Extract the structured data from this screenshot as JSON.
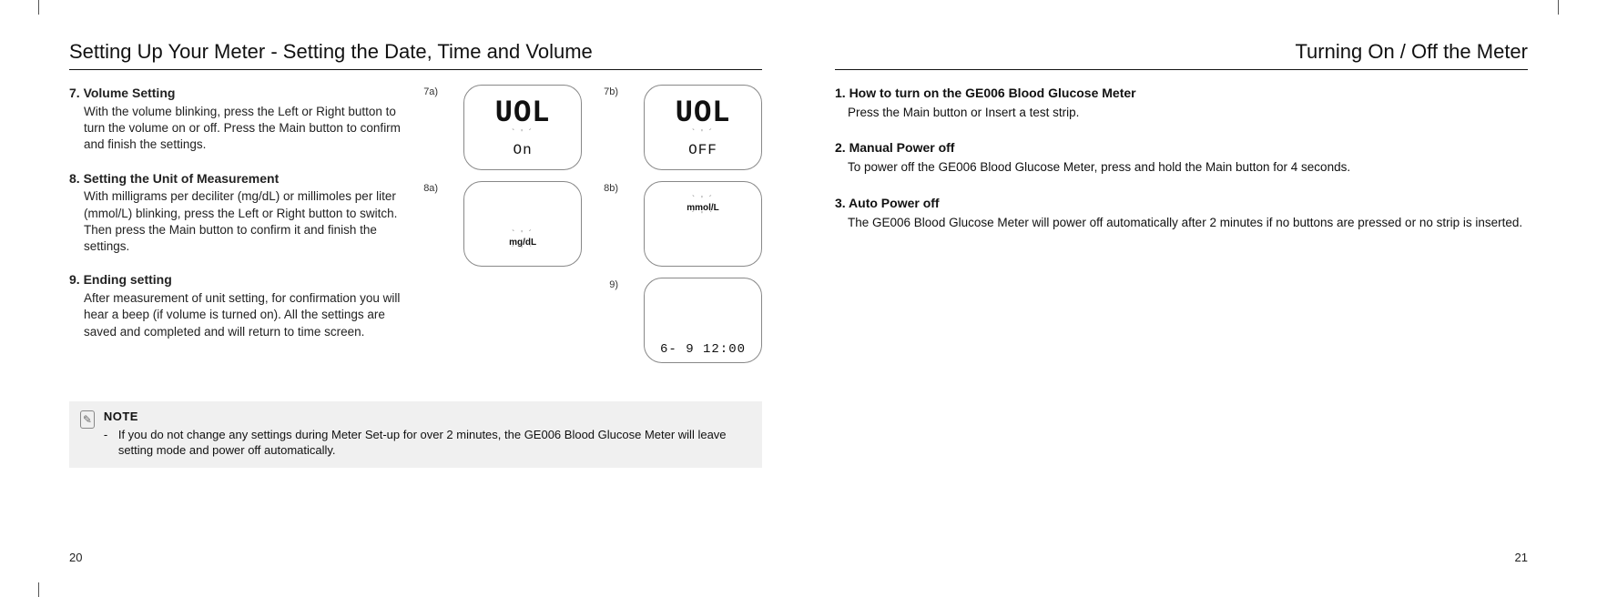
{
  "left": {
    "heading": "Setting Up Your Meter - Setting the Date, Time and Volume",
    "page_number": "20",
    "sections": [
      {
        "title": "7. Volume Setting",
        "body": "With the volume blinking, press the Left or Right button to turn the volume on or off. Press the Main button to confirm and finish the settings."
      },
      {
        "title": "8. Setting the Unit of Measurement",
        "body": "With milligrams per deciliter (mg/dL) or millimoles per liter (mmol/L) blinking, press the Left or Right button to switch. Then press the Main button to confirm it and finish the settings."
      },
      {
        "title": "9. Ending setting",
        "body": "After measurement of unit setting, for confirmation you will hear a beep (if volume is turned on). All the settings are saved and completed and will return to time screen."
      }
    ],
    "note": {
      "label": "NOTE",
      "body": "If you do not change any settings during Meter Set-up for over 2 minutes, the GE006 Blood Glucose Meter will leave setting mode and power off automatically."
    },
    "figures": {
      "f7a": {
        "label": "7a)",
        "big": "UOL",
        "small": "On"
      },
      "f7b": {
        "label": "7b)",
        "big": "UOL",
        "small": "OFF"
      },
      "f8a": {
        "label": "8a)",
        "unit": "mg/dL"
      },
      "f8b": {
        "label": "8b)",
        "unit": "mmol/L"
      },
      "f9": {
        "label": "9)",
        "bottom": "6- 9 12:00"
      }
    }
  },
  "right": {
    "heading": "Turning On / Off the Meter",
    "page_number": "21",
    "sections": [
      {
        "title": "1. How to turn on the GE006 Blood Glucose Meter",
        "body": "Press the Main button or  Insert a test strip."
      },
      {
        "title": "2. Manual Power off",
        "body": "To power off the GE006 Blood Glucose Meter, press and hold the Main button for 4 seconds."
      },
      {
        "title": "3. Auto Power off",
        "body": "The GE006 Blood Glucose Meter will power off automatically after 2 minutes if no buttons are pressed or no strip is inserted."
      }
    ]
  }
}
